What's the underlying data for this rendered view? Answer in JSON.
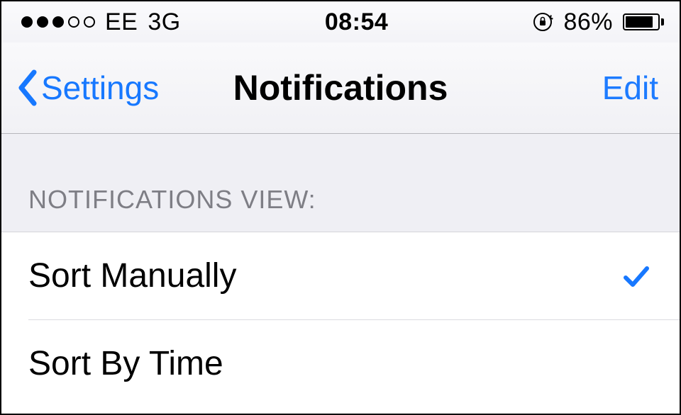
{
  "status_bar": {
    "signal_strength": 3,
    "signal_max": 5,
    "carrier": "EE",
    "network_type": "3G",
    "time": "08:54",
    "orientation_locked": true,
    "battery_percent_label": "86%",
    "battery_fill_percent": 86
  },
  "nav": {
    "back_label": "Settings",
    "title": "Notifications",
    "edit_label": "Edit"
  },
  "section": {
    "header": "NOTIFICATIONS VIEW:",
    "options": [
      {
        "label": "Sort Manually",
        "selected": true
      },
      {
        "label": "Sort By Time",
        "selected": false
      }
    ]
  },
  "colors": {
    "accent": "#1778ff",
    "section_bg": "#efeff4",
    "separator": "#d4d4d9"
  }
}
